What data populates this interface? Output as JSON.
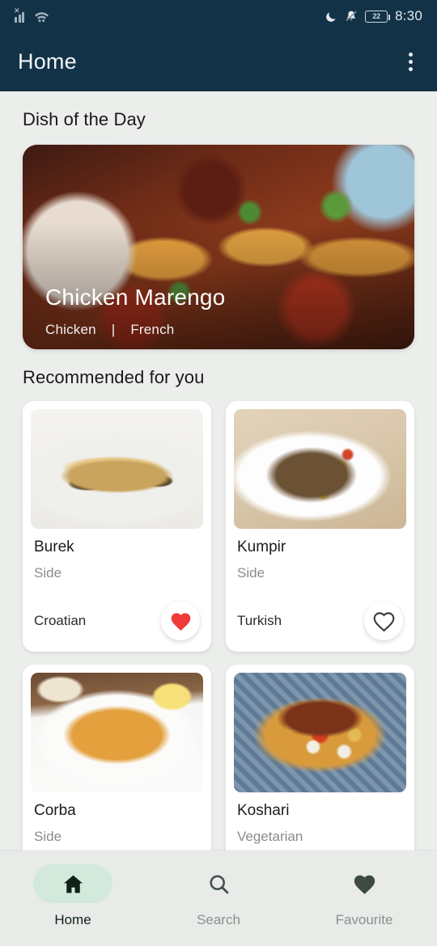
{
  "statusbar": {
    "signal_icon": "signal-bars-no-sim-icon",
    "wifi_icon": "wifi-icon",
    "dnd_icon": "moon-icon",
    "mute_icon": "bell-muted-icon",
    "battery_level": "22",
    "time": "8:30"
  },
  "appbar": {
    "title": "Home",
    "menu_icon": "overflow-menu-icon"
  },
  "sections": {
    "dish_of_the_day_title": "Dish of the Day",
    "recommended_title": "Recommended for you"
  },
  "hero": {
    "name": "Chicken Marengo",
    "category": "Chicken",
    "separator": "|",
    "area": "French",
    "image": "chicken-marengo-photo"
  },
  "cards": [
    {
      "name": "Burek",
      "category": "Side",
      "area": "Croatian",
      "image": "burek-photo",
      "favourite": true,
      "fav_icon": "heart-filled-icon",
      "fav_color": "#ef3b39"
    },
    {
      "name": "Kumpir",
      "category": "Side",
      "area": "Turkish",
      "image": "kumpir-photo",
      "favourite": false,
      "fav_icon": "heart-outline-icon",
      "fav_color": "#3d3d3d"
    },
    {
      "name": "Corba",
      "category": "Side",
      "area": "",
      "image": "corba-photo",
      "favourite": false,
      "fav_icon": "heart-outline-icon",
      "fav_color": "#3d3d3d"
    },
    {
      "name": "Koshari",
      "category": "Vegetarian",
      "area": "",
      "image": "koshari-photo",
      "favourite": false,
      "fav_icon": "heart-outline-icon",
      "fav_color": "#3d3d3d"
    }
  ],
  "bottomnav": {
    "items": [
      {
        "label": "Home",
        "icon": "home-icon",
        "active": true
      },
      {
        "label": "Search",
        "icon": "search-icon",
        "active": false
      },
      {
        "label": "Favourite",
        "icon": "heart-filled-icon",
        "active": false
      }
    ]
  },
  "colors": {
    "appbar": "#123247",
    "background": "#eceeec",
    "nav_active_pill": "#d2e9dc",
    "nav_active_icon": "#10211a",
    "heart_red": "#ef3b39"
  }
}
